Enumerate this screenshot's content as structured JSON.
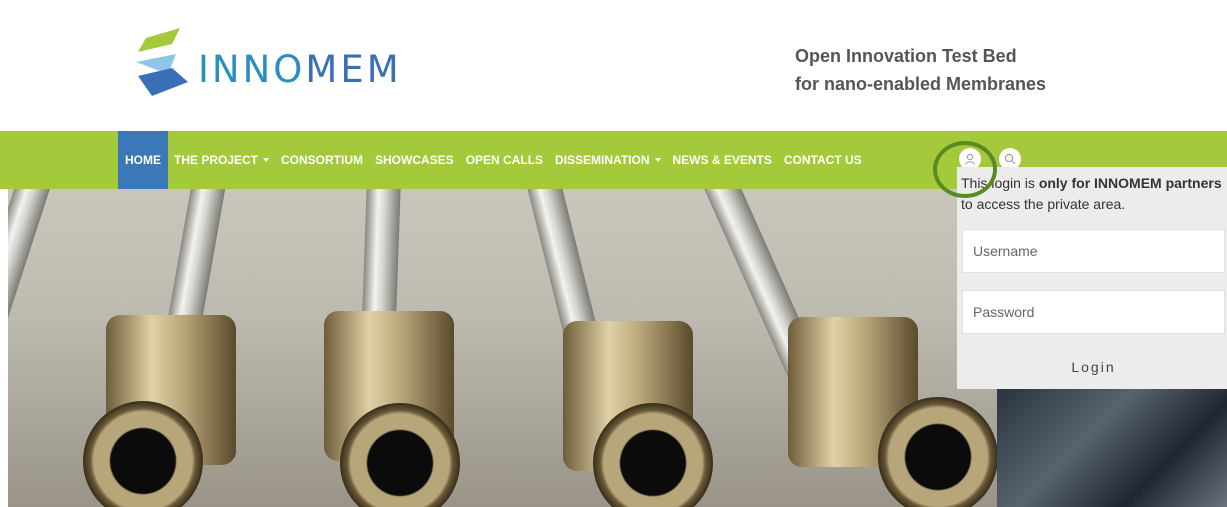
{
  "brand": {
    "logo_text_a": "INNO",
    "logo_text_b": "MEM",
    "tagline_line1": "Open Innovation Test Bed",
    "tagline_line2": "for nano-enabled Membranes"
  },
  "nav": {
    "items": [
      {
        "label": "HOME",
        "active": true,
        "dropdown": false
      },
      {
        "label": "THE PROJECT",
        "active": false,
        "dropdown": true
      },
      {
        "label": "CONSORTIUM",
        "active": false,
        "dropdown": false
      },
      {
        "label": "SHOWCASES",
        "active": false,
        "dropdown": false
      },
      {
        "label": "OPEN CALLS",
        "active": false,
        "dropdown": false
      },
      {
        "label": "DISSEMINATION",
        "active": false,
        "dropdown": true
      },
      {
        "label": "NEWS & EVENTS",
        "active": false,
        "dropdown": false
      },
      {
        "label": "CONTACT US",
        "active": false,
        "dropdown": false
      }
    ],
    "icons": [
      "user-icon",
      "search-icon"
    ]
  },
  "login": {
    "msg_prefix": "This login is ",
    "msg_bold1": "only for INNOMEM partners",
    "msg_suffix": " to access the private area.",
    "username_placeholder": "Username",
    "password_placeholder": "Password",
    "button_label": "Login"
  },
  "colors": {
    "nav_green": "#a4c93a",
    "active_blue": "#3a78b8",
    "logo_blue": "#2a8fbf",
    "highlight_ring": "#5b8a22"
  }
}
